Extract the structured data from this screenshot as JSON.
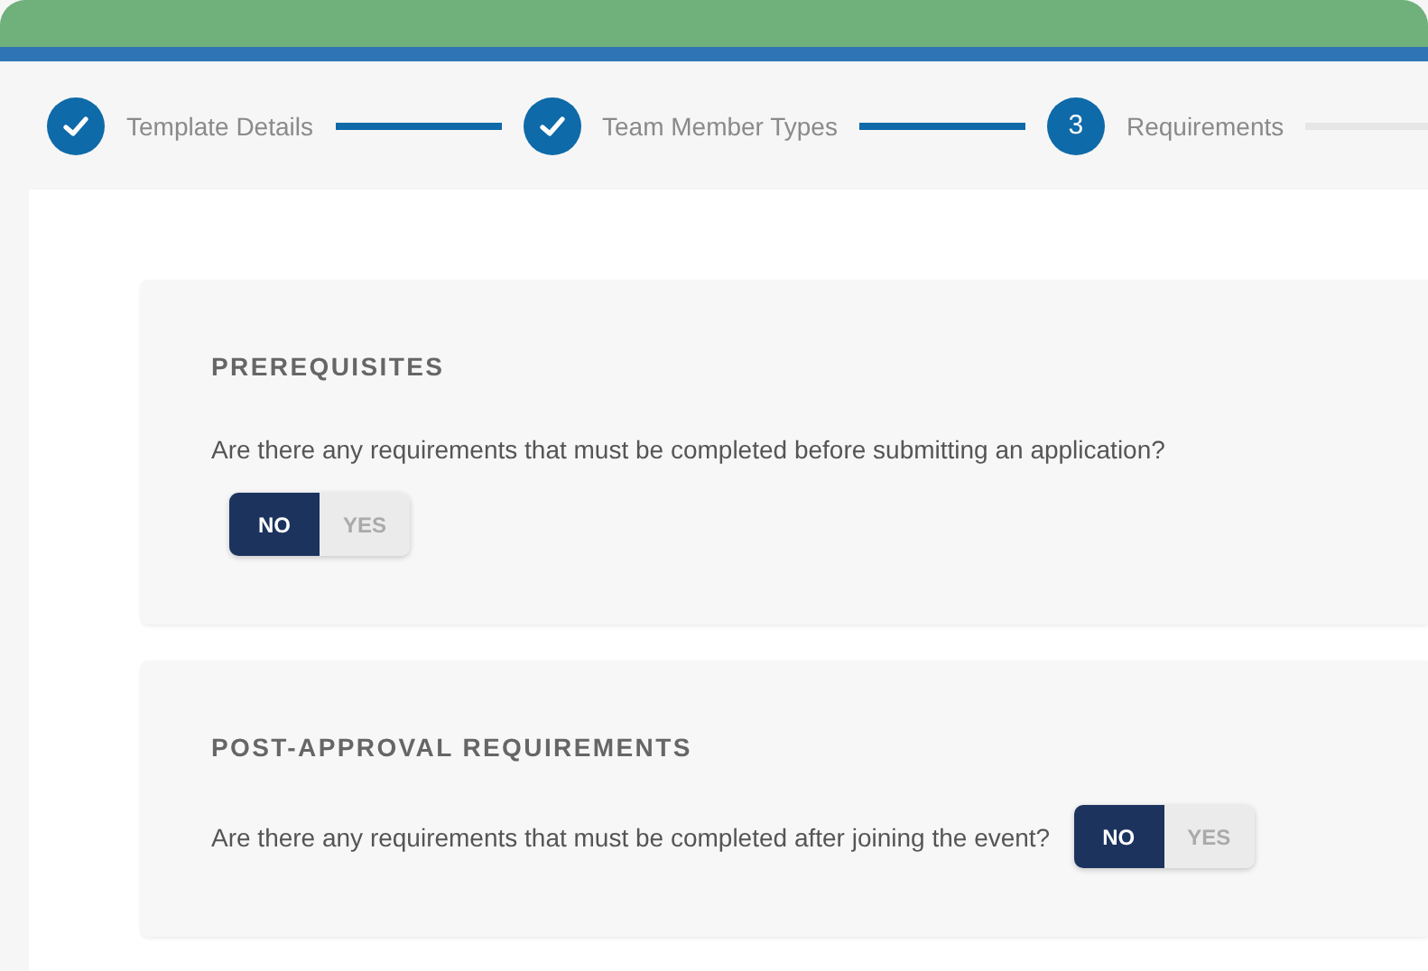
{
  "steps": [
    {
      "label": "Template Details",
      "completed": true
    },
    {
      "label": "Team Member Types",
      "completed": true
    },
    {
      "label": "Requirements",
      "completed": false,
      "number": "3"
    }
  ],
  "sections": [
    {
      "title": "PREREQUISITES",
      "question": "Are there any requirements that must be completed before submitting an application?",
      "kind": "stacked",
      "options": [
        {
          "label": "NO",
          "selected": true
        },
        {
          "label": "YES",
          "selected": false
        }
      ]
    },
    {
      "title": "POST-APPROVAL REQUIREMENTS",
      "question": "Are there any requirements that must be completed after joining the event?",
      "kind": "inline",
      "options": [
        {
          "label": "NO",
          "selected": true
        },
        {
          "label": "YES",
          "selected": false
        }
      ]
    }
  ]
}
